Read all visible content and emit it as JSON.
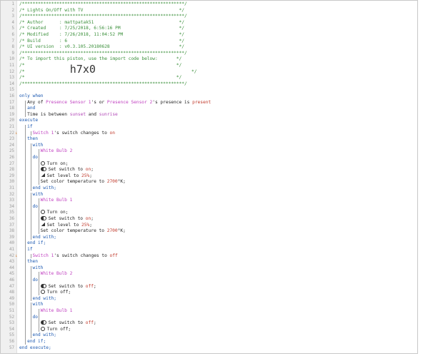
{
  "editor": {
    "lines": [
      {
        "n": "1",
        "parts": [
          {
            "t": "/*************************************************************/",
            "c": "comment"
          }
        ]
      },
      {
        "n": "2",
        "parts": [
          {
            "t": "/* Lights On/Off with TV                                    */",
            "c": "comment"
          }
        ]
      },
      {
        "n": "3",
        "parts": [
          {
            "t": "/*************************************************************/",
            "c": "comment"
          }
        ]
      },
      {
        "n": "4",
        "parts": [
          {
            "t": "/* Author      : mattpatak51                                */",
            "c": "comment"
          }
        ]
      },
      {
        "n": "5",
        "parts": [
          {
            "t": "/* Created     : 7/25/2018, 6:56:16 PM                      */",
            "c": "comment"
          }
        ]
      },
      {
        "n": "6",
        "parts": [
          {
            "t": "/* Modified    : 7/26/2018, 11:04:52 PM                     */",
            "c": "comment"
          }
        ]
      },
      {
        "n": "7",
        "parts": [
          {
            "t": "/* Build       : 6                                          */",
            "c": "comment"
          }
        ]
      },
      {
        "n": "8",
        "parts": [
          {
            "t": "/* UI version  : v0.3.105.20180628                          */",
            "c": "comment"
          }
        ]
      },
      {
        "n": "9",
        "parts": [
          {
            "t": "/*************************************************************/",
            "c": "comment"
          }
        ]
      },
      {
        "n": "10",
        "parts": [
          {
            "t": "/* To import this piston, use the import code below:       */",
            "c": "comment"
          }
        ]
      },
      {
        "n": "11",
        "parts": [
          {
            "t": "/*                                                         */",
            "c": "comment"
          }
        ]
      },
      {
        "n": "12",
        "parts": [
          {
            "t": "/*                 ",
            "c": "comment"
          },
          {
            "t": "h7x0",
            "c": "big"
          },
          {
            "t": "                                    */",
            "c": "comment"
          }
        ]
      },
      {
        "n": "13",
        "parts": [
          {
            "t": "/*                                                         */",
            "c": "comment"
          }
        ]
      },
      {
        "n": "14",
        "parts": [
          {
            "t": "/*************************************************************/",
            "c": "comment"
          }
        ]
      },
      {
        "n": "15",
        "parts": []
      },
      {
        "n": "16",
        "parts": [
          {
            "t": "only when",
            "c": "kw"
          }
        ]
      },
      {
        "n": "17",
        "indent": 3,
        "parts": [
          {
            "t": "Any of ",
            "c": ""
          },
          {
            "t": "Presence Sensor 1",
            "c": "dev"
          },
          {
            "t": "'s or ",
            "c": ""
          },
          {
            "t": "Presence Sensor 2",
            "c": "dev"
          },
          {
            "t": "'s presence is ",
            "c": ""
          },
          {
            "t": "present",
            "c": "val"
          }
        ]
      },
      {
        "n": "18",
        "indent": 3,
        "parts": [
          {
            "t": "and",
            "c": "kw"
          }
        ]
      },
      {
        "n": "19",
        "indent": 3,
        "parts": [
          {
            "t": "Time is between ",
            "c": ""
          },
          {
            "t": "sunset",
            "c": "fn"
          },
          {
            "t": " and ",
            "c": ""
          },
          {
            "t": "sunrise",
            "c": "fn"
          }
        ]
      },
      {
        "n": "20",
        "parts": [
          {
            "t": "execute",
            "c": "kw"
          }
        ]
      },
      {
        "n": "21",
        "indent": 3,
        "parts": [
          {
            "t": "if",
            "c": "kw"
          }
        ]
      },
      {
        "n": "22",
        "indent": 5,
        "mark": "↓",
        "parts": [
          {
            "t": "Switch 1",
            "c": "dev"
          },
          {
            "t": "'s switch changes to ",
            "c": ""
          },
          {
            "t": "on",
            "c": "val"
          }
        ]
      },
      {
        "n": "23",
        "indent": 3,
        "parts": [
          {
            "t": "then",
            "c": "kw"
          }
        ]
      },
      {
        "n": "24",
        "indent": 5,
        "parts": [
          {
            "t": "with",
            "c": "kw"
          }
        ]
      },
      {
        "n": "25",
        "indent": 8,
        "parts": [
          {
            "t": "White Bulb 2",
            "c": "dev"
          }
        ]
      },
      {
        "n": "26",
        "indent": 5,
        "parts": [
          {
            "t": "do",
            "c": "kw"
          }
        ]
      },
      {
        "n": "27",
        "indent": 8,
        "icon": "power",
        "parts": [
          {
            "t": "Turn on;",
            "c": ""
          }
        ]
      },
      {
        "n": "28",
        "indent": 8,
        "icon": "toggle-on",
        "parts": [
          {
            "t": "Set switch to ",
            "c": ""
          },
          {
            "t": "on",
            "c": "val"
          },
          {
            "t": ";",
            "c": ""
          }
        ]
      },
      {
        "n": "29",
        "indent": 8,
        "icon": "level",
        "parts": [
          {
            "t": "Set level to ",
            "c": ""
          },
          {
            "t": "25%",
            "c": "val"
          },
          {
            "t": ";",
            "c": ""
          }
        ]
      },
      {
        "n": "30",
        "indent": 8,
        "parts": [
          {
            "t": "Set color temperature to ",
            "c": ""
          },
          {
            "t": "2700",
            "c": "val"
          },
          {
            "t": "°K;",
            "c": ""
          }
        ]
      },
      {
        "n": "31",
        "indent": 5,
        "parts": [
          {
            "t": "end with;",
            "c": "kw"
          }
        ]
      },
      {
        "n": "32",
        "indent": 5,
        "parts": [
          {
            "t": "with",
            "c": "kw"
          }
        ]
      },
      {
        "n": "33",
        "indent": 8,
        "parts": [
          {
            "t": "White Bulb 1",
            "c": "dev"
          }
        ]
      },
      {
        "n": "34",
        "indent": 5,
        "parts": [
          {
            "t": "do",
            "c": "kw"
          }
        ]
      },
      {
        "n": "35",
        "indent": 8,
        "icon": "power",
        "parts": [
          {
            "t": "Turn on;",
            "c": ""
          }
        ]
      },
      {
        "n": "36",
        "indent": 8,
        "icon": "toggle-on",
        "parts": [
          {
            "t": "Set switch to ",
            "c": ""
          },
          {
            "t": "on",
            "c": "val"
          },
          {
            "t": ";",
            "c": ""
          }
        ]
      },
      {
        "n": "37",
        "indent": 8,
        "icon": "level",
        "parts": [
          {
            "t": "Set level to ",
            "c": ""
          },
          {
            "t": "25%",
            "c": "val"
          },
          {
            "t": ";",
            "c": ""
          }
        ]
      },
      {
        "n": "38",
        "indent": 8,
        "parts": [
          {
            "t": "Set color temperature to ",
            "c": ""
          },
          {
            "t": "2700",
            "c": "val"
          },
          {
            "t": "°K;",
            "c": ""
          }
        ]
      },
      {
        "n": "39",
        "indent": 5,
        "parts": [
          {
            "t": "end with;",
            "c": "kw"
          }
        ]
      },
      {
        "n": "40",
        "indent": 3,
        "parts": [
          {
            "t": "end if;",
            "c": "kw"
          }
        ]
      },
      {
        "n": "41",
        "indent": 3,
        "parts": [
          {
            "t": "if",
            "c": "kw"
          }
        ]
      },
      {
        "n": "42",
        "indent": 5,
        "mark": "↓",
        "parts": [
          {
            "t": "Switch 1",
            "c": "dev"
          },
          {
            "t": "'s switch changes to ",
            "c": ""
          },
          {
            "t": "off",
            "c": "val"
          }
        ]
      },
      {
        "n": "43",
        "indent": 3,
        "parts": [
          {
            "t": "then",
            "c": "kw"
          }
        ]
      },
      {
        "n": "44",
        "indent": 5,
        "parts": [
          {
            "t": "with",
            "c": "kw"
          }
        ]
      },
      {
        "n": "45",
        "indent": 8,
        "parts": [
          {
            "t": "White Bulb 2",
            "c": "dev"
          }
        ]
      },
      {
        "n": "46",
        "indent": 5,
        "parts": [
          {
            "t": "do",
            "c": "kw"
          }
        ]
      },
      {
        "n": "47",
        "indent": 8,
        "icon": "toggle-on",
        "parts": [
          {
            "t": "Set switch to ",
            "c": ""
          },
          {
            "t": "off",
            "c": "val"
          },
          {
            "t": ";",
            "c": ""
          }
        ]
      },
      {
        "n": "48",
        "indent": 8,
        "icon": "toggle-off",
        "parts": [
          {
            "t": "Turn off;",
            "c": ""
          }
        ]
      },
      {
        "n": "49",
        "indent": 5,
        "parts": [
          {
            "t": "end with;",
            "c": "kw"
          }
        ]
      },
      {
        "n": "50",
        "indent": 5,
        "parts": [
          {
            "t": "with",
            "c": "kw"
          }
        ]
      },
      {
        "n": "51",
        "indent": 8,
        "parts": [
          {
            "t": "White Bulb 1",
            "c": "dev"
          }
        ]
      },
      {
        "n": "52",
        "indent": 5,
        "parts": [
          {
            "t": "do",
            "c": "kw"
          }
        ]
      },
      {
        "n": "53",
        "indent": 8,
        "icon": "toggle-on",
        "parts": [
          {
            "t": "Set switch to ",
            "c": ""
          },
          {
            "t": "off",
            "c": "val"
          },
          {
            "t": ";",
            "c": ""
          }
        ]
      },
      {
        "n": "54",
        "indent": 8,
        "icon": "toggle-off",
        "parts": [
          {
            "t": "Turn off;",
            "c": ""
          }
        ]
      },
      {
        "n": "55",
        "indent": 5,
        "parts": [
          {
            "t": "end with;",
            "c": "kw"
          }
        ]
      },
      {
        "n": "56",
        "indent": 3,
        "parts": [
          {
            "t": "end if;",
            "c": "kw"
          }
        ]
      },
      {
        "n": "57",
        "parts": [
          {
            "t": "end execute;",
            "c": "kw"
          }
        ]
      }
    ]
  }
}
